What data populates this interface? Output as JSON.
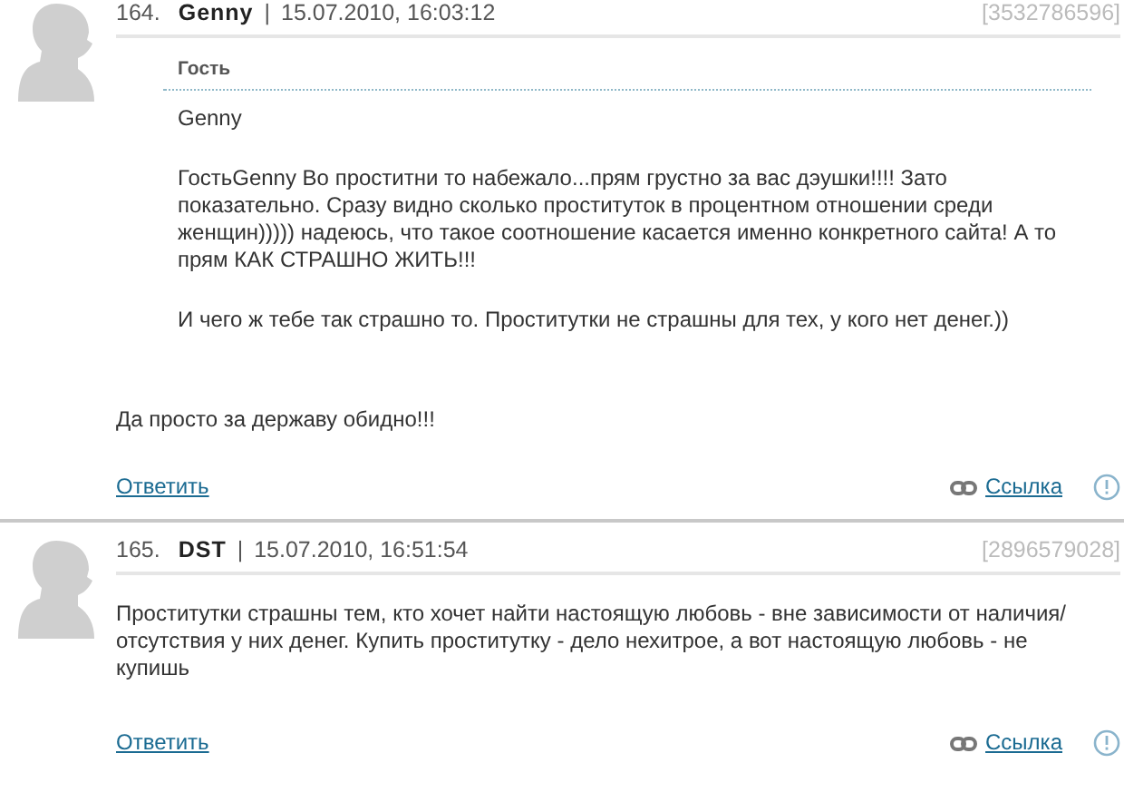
{
  "comments": [
    {
      "number": "164.",
      "author": "Genny",
      "separator": "|",
      "date": "15.07.2010, 16:03:12",
      "id": "[3532786596]",
      "quote": {
        "title": "Гость",
        "paragraphs": [
          "Genny",
          "ГостьGenny Во проститни то набежало...прям грустно за вас дэушки!!!! Зато показательно. Сразу видно сколько проституток в процентном отношении среди женщин))))) надеюсь, что такое соотношение касается именно конкретного сайта! А то прям КАК СТРАШНО ЖИТЬ!!!",
          "И чего ж тебе так страшно то. Проститутки не страшны для тех, у кого нет денег.))"
        ]
      },
      "text": "Да просто за державу обидно!!!",
      "reply": "Ответить",
      "link": "Ссылка"
    },
    {
      "number": "165.",
      "author": "DST",
      "separator": "|",
      "date": "15.07.2010, 16:51:54",
      "id": "[2896579028]",
      "text": "Проститутки страшны тем, кто хочет найти настоящую любовь - вне зависимости от наличия/отсутствия у них денег. Купить проститутку - дело нехитрое, а вот настоящую любовь - не купишь",
      "reply": "Ответить",
      "link": "Ссылка"
    }
  ]
}
